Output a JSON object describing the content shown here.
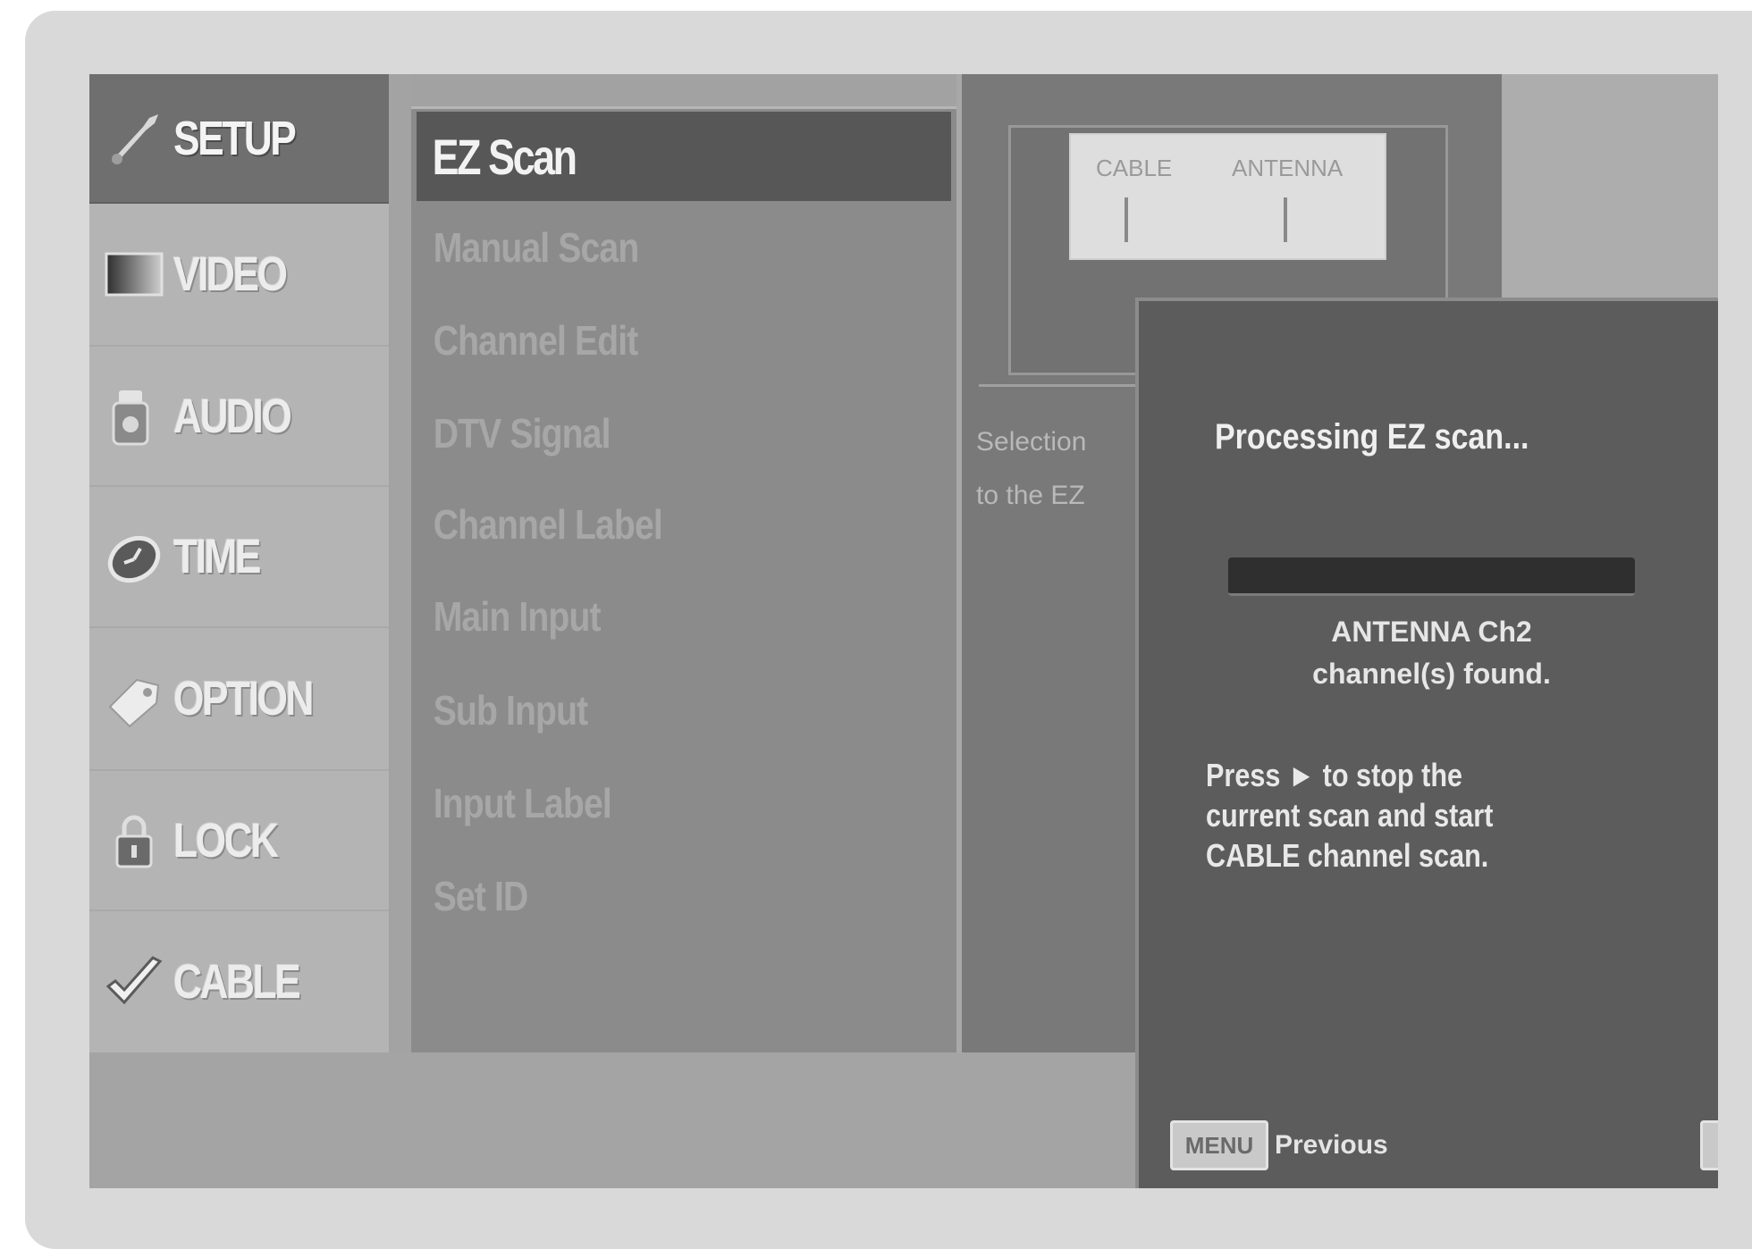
{
  "sidebar": {
    "items": [
      {
        "label": "SETUP",
        "icon": "setup-icon",
        "selected": true
      },
      {
        "label": "VIDEO",
        "icon": "video-icon",
        "selected": false
      },
      {
        "label": "AUDIO",
        "icon": "audio-icon",
        "selected": false
      },
      {
        "label": "TIME",
        "icon": "clock-icon",
        "selected": false
      },
      {
        "label": "OPTION",
        "icon": "tag-icon",
        "selected": false
      },
      {
        "label": "LOCK",
        "icon": "lock-icon",
        "selected": false
      },
      {
        "label": "CABLE",
        "icon": "checkmark-icon",
        "selected": false
      }
    ]
  },
  "menu": {
    "selected_label": "EZ Scan",
    "items": [
      {
        "label": "Manual Scan"
      },
      {
        "label": "Channel Edit"
      },
      {
        "label": "DTV Signal"
      },
      {
        "label": "Channel Label"
      },
      {
        "label": "Main Input"
      },
      {
        "label": "Sub Input"
      },
      {
        "label": "Input Label"
      },
      {
        "label": "Set ID"
      }
    ]
  },
  "preview": {
    "cable_label": "CABLE",
    "antenna_label": "ANTENNA",
    "desc_line1": "Selection",
    "desc_line2": "to the EZ"
  },
  "dialog": {
    "title": "Processing EZ scan...",
    "progress": 0,
    "result_line1": "ANTENNA Ch2",
    "result_line2": "channel(s) found.",
    "instructions": [
      "Press ► to stop the",
      "current scan and start",
      "CABLE channel scan."
    ],
    "menu_key": "MENU",
    "previous_label": "Previous"
  },
  "colors": {
    "selected_item_bg": "#575757",
    "dialog_bg": "#5c5c5c",
    "sidebar_bg": "#b4b4b4",
    "menu_bg": "#8b8b8b"
  }
}
